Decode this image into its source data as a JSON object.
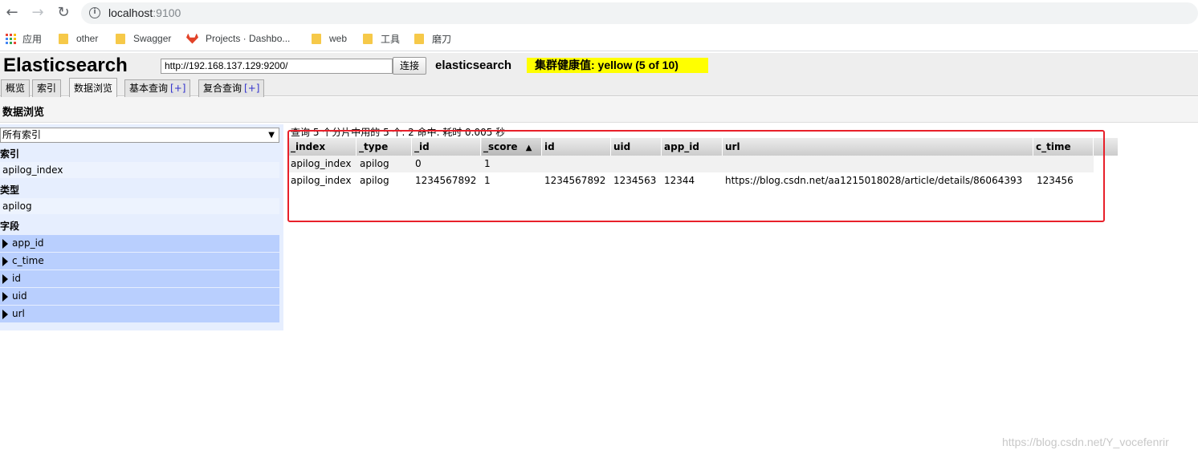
{
  "browser": {
    "url_host": "localhost",
    "url_port": ":9100",
    "bookmarks": [
      "应用",
      "other",
      "Swagger",
      "Projects · Dashbo...",
      "web",
      "工具",
      "磨刀"
    ]
  },
  "app": {
    "title": "Elasticsearch",
    "cluster_url": "http://192.168.137.129:9200/",
    "connect_label": "连接",
    "cluster_name": "elasticsearch",
    "health": "集群健康值: yellow (5 of 10)",
    "tabs": [
      "概览",
      "索引",
      "数据浏览",
      "基本查询",
      "复合查询"
    ],
    "tab_plus": "[+]",
    "section_title": "数据浏览"
  },
  "sidebar": {
    "index_select": "所有索引",
    "index_heading": "索引",
    "index_item": "apilog_index",
    "type_heading": "类型",
    "type_item": "apilog",
    "fields_heading": "字段",
    "fields": [
      "app_id",
      "c_time",
      "id",
      "uid",
      "url"
    ]
  },
  "results": {
    "summary": "查询 5 个分片中用的 5 个. 2 命中. 耗时 0.005 秒",
    "columns": [
      "_index",
      "_type",
      "_id",
      "_score",
      "id",
      "uid",
      "app_id",
      "url",
      "c_time"
    ],
    "sort_indicator": "▲",
    "rows": [
      [
        "apilog_index",
        "apilog",
        "0",
        "1",
        "",
        "",
        "",
        "",
        ""
      ],
      [
        "apilog_index",
        "apilog",
        "1234567892",
        "1",
        "1234567892",
        "1234563",
        "12344",
        "https://blog.csdn.net/aa1215018028/article/details/86064393",
        "123456"
      ]
    ]
  },
  "watermark": "https://blog.csdn.net/Y_vocefenrir",
  "colors": {
    "health": "#ffff00",
    "highlight_box": "#e8202a",
    "field_bg": "#b9cffe"
  }
}
